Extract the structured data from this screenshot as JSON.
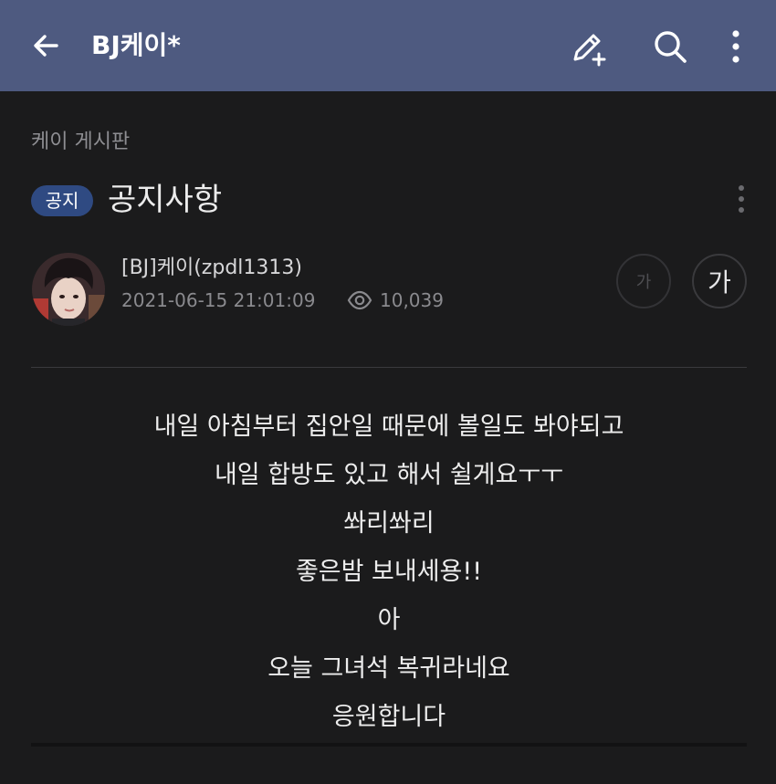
{
  "header": {
    "title": "BJ케이*",
    "icons": [
      "back-arrow-icon",
      "write-icon",
      "search-icon",
      "more-vert-icon"
    ]
  },
  "post": {
    "board_name": "케이 게시판",
    "badge": "공지",
    "title": "공지사항",
    "author": "[BJ]케이(zpdl1313)",
    "date": "2021-06-15 21:01:09",
    "views": "10,039",
    "font_small_label": "가",
    "font_large_label": "가",
    "body_lines": [
      "내일 아침부터 집안일 때문에 볼일도 봐야되고",
      "내일 합방도 있고 해서 쉴게요ㅜㅜ",
      "쏴리쏴리",
      "좋은밤 보내세용!!",
      "아",
      "오늘 그녀석 복귀라네요",
      "응원합니다"
    ]
  },
  "colors": {
    "topbar": "#4e5a80",
    "background": "#1b1b1c",
    "badge": "#2f4a82"
  }
}
